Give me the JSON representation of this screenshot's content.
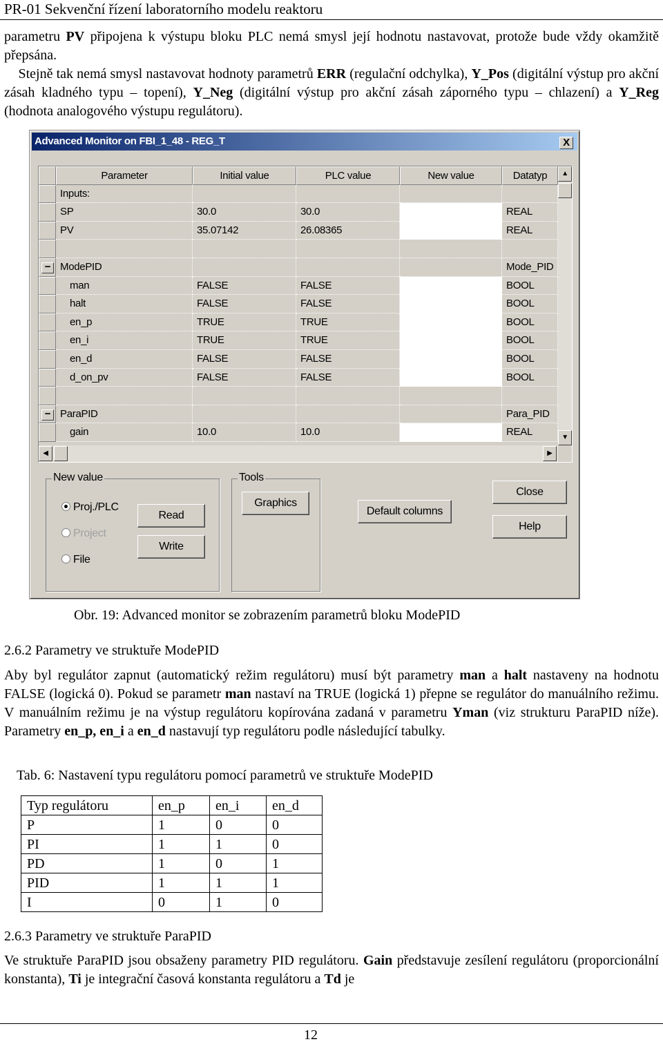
{
  "header": {
    "title": "PR-01 Sekvenční řízení laboratorního modelu reaktoru"
  },
  "intro": [
    {
      "t": "parametru "
    },
    {
      "t": "PV",
      "b": 1
    },
    {
      "t": " připojena k výstupu bloku PLC nemá smysl její hodnotu nastavovat, protože bude vždy okamžitě přepsána."
    },
    {
      "br": 1
    },
    {
      "t": "Stejně tak nemá smysl nastavovat hodnoty parametrů "
    },
    {
      "t": "ERR",
      "b": 1
    },
    {
      "t": " (regulační odchylka), "
    },
    {
      "t": "Y_Pos",
      "b": 1
    },
    {
      "t": " (digitální výstup pro akční zásah kladného typu – topení), "
    },
    {
      "t": "Y_Neg",
      "b": 1
    },
    {
      "t": " (digitální výstup pro akční zásah záporného typu – chlazení) a "
    },
    {
      "t": "Y_Reg",
      "b": 1
    },
    {
      "t": " (hodnota analogového výstupu regulátoru)."
    }
  ],
  "dialog": {
    "title": "Advanced Monitor on  FBI_1_48  -  REG_T",
    "close_x": "X",
    "columns": [
      "Parameter",
      "Initial value",
      "PLC value",
      "New value",
      "Datatyp"
    ],
    "rows": [
      {
        "p": "Inputs:",
        "i": "",
        "v": "",
        "d": ""
      },
      {
        "p": "SP",
        "i": "30.0",
        "v": "30.0",
        "d": "REAL",
        "nv": 1
      },
      {
        "p": "PV",
        "i": "35.07142",
        "v": "26.08365",
        "d": "REAL",
        "nv": 1
      },
      {
        "p": "",
        "i": "",
        "v": "",
        "d": ""
      },
      {
        "p": "ModePID",
        "i": "",
        "v": "",
        "d": "Mode_PID",
        "exp": "−"
      },
      {
        "p": "man",
        "i": "FALSE",
        "v": "FALSE",
        "d": "BOOL",
        "nv": 1,
        "sub": 1
      },
      {
        "p": "halt",
        "i": "FALSE",
        "v": "FALSE",
        "d": "BOOL",
        "nv": 1,
        "sub": 1
      },
      {
        "p": "en_p",
        "i": "TRUE",
        "v": "TRUE",
        "d": "BOOL",
        "nv": 1,
        "sub": 1
      },
      {
        "p": "en_i",
        "i": "TRUE",
        "v": "TRUE",
        "d": "BOOL",
        "nv": 1,
        "sub": 1
      },
      {
        "p": "en_d",
        "i": "FALSE",
        "v": "FALSE",
        "d": "BOOL",
        "nv": 1,
        "sub": 1
      },
      {
        "p": "d_on_pv",
        "i": "FALSE",
        "v": "FALSE",
        "d": "BOOL",
        "nv": 1,
        "sub": 1
      },
      {
        "p": "",
        "i": "",
        "v": "",
        "d": ""
      },
      {
        "p": "ParaPID",
        "i": "",
        "v": "",
        "d": "Para_PID",
        "exp": "−"
      },
      {
        "p": "gain",
        "i": "10.0",
        "v": "10.0",
        "d": "REAL",
        "nv": 1,
        "sub": 1
      }
    ],
    "new_value_group": "New value",
    "radio": [
      {
        "label": "Proj./PLC",
        "checked": true
      },
      {
        "label": "Project",
        "disabled": true
      },
      {
        "label": "File"
      }
    ],
    "read": "Read",
    "write": "Write",
    "tools_group": "Tools",
    "graphics": "Graphics",
    "default_columns": "Default columns",
    "close": "Close",
    "help": "Help"
  },
  "figure_caption": "Obr. 19: Advanced monitor se zobrazením parametrů bloku ModePID",
  "section_262": "2.6.2 Parametry ve struktuře ModePID",
  "para_262": [
    {
      "t": "Aby byl regulátor zapnut (automatický režim regulátoru) musí být parametry "
    },
    {
      "t": "man",
      "b": 1
    },
    {
      "t": " a "
    },
    {
      "t": "halt",
      "b": 1
    },
    {
      "t": " nastaveny na hodnotu FALSE (logická 0). Pokud se parametr "
    },
    {
      "t": "man",
      "b": 1
    },
    {
      "t": " nastaví na TRUE (logická 1) přepne se regulátor do manuálního režimu. V manuálním režimu je na výstup regulátoru kopírována zadaná v parametru "
    },
    {
      "t": "Yman",
      "b": 1
    },
    {
      "t": " (viz strukturu ParaPID níže). Parametry "
    },
    {
      "t": "en_p, en_i",
      "b": 1
    },
    {
      "t": " a "
    },
    {
      "t": "en_d",
      "b": 1
    },
    {
      "t": " nastavují typ regulátoru podle následující tabulky."
    }
  ],
  "table_caption": "Tab. 6:  Nastavení typu regulátoru pomocí parametrů ve struktuře ModePID",
  "table": [
    [
      "Typ regulátoru",
      "en_p",
      "en_i",
      "en_d"
    ],
    [
      "P",
      "1",
      "0",
      "0"
    ],
    [
      "PI",
      "1",
      "1",
      "0"
    ],
    [
      "PD",
      "1",
      "0",
      "1"
    ],
    [
      "PID",
      "1",
      "1",
      "1"
    ],
    [
      "I",
      "0",
      "1",
      "0"
    ]
  ],
  "section_263": "2.6.3 Parametry ve struktuře ParaPID",
  "para_263": [
    {
      "t": "Ve struktuře ParaPID jsou obsaženy parametry PID regulátoru. "
    },
    {
      "t": "Gain",
      "b": 1
    },
    {
      "t": " představuje zesílení regulátoru (proporcionální konstanta), "
    },
    {
      "t": "Ti",
      "b": 1
    },
    {
      "t": " je integrační časová konstanta regulátoru a "
    },
    {
      "t": "Td",
      "b": 1
    },
    {
      "t": " je"
    }
  ],
  "page_number": "12"
}
